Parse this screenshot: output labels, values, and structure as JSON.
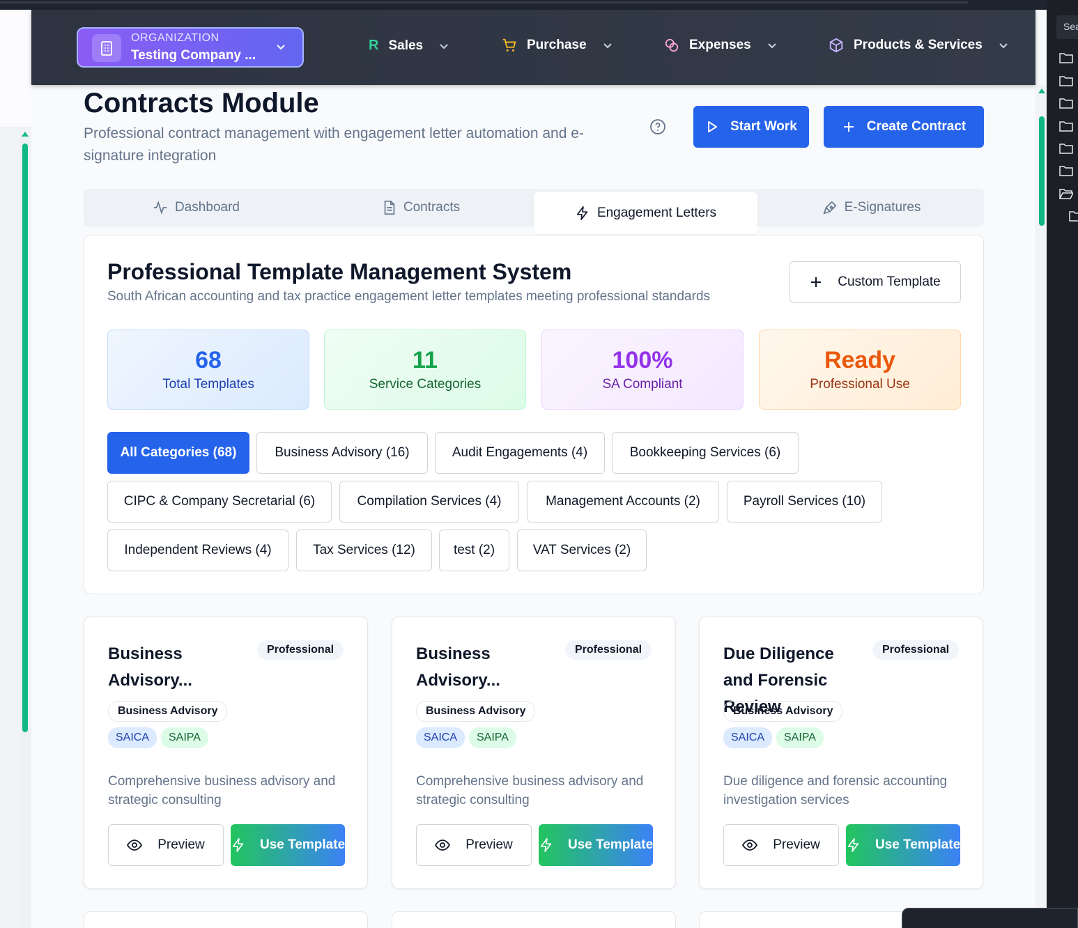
{
  "organization": {
    "label": "ORGANIZATION",
    "name": "Testing Company ..."
  },
  "nav": [
    {
      "label": "Sales",
      "icon": "r-letter-icon"
    },
    {
      "label": "Purchase",
      "icon": "cart-icon"
    },
    {
      "label": "Expenses",
      "icon": "coins-icon"
    },
    {
      "label": "Products & Services",
      "icon": "box-icon"
    }
  ],
  "page": {
    "title": "Contracts Module",
    "subtitle": "Professional contract management with engagement letter automation and e-signature integration",
    "start_work": "Start Work",
    "create_contract": "Create Contract"
  },
  "tabs": [
    {
      "label": "Dashboard"
    },
    {
      "label": "Contracts"
    },
    {
      "label": "Engagement Letters",
      "active": true
    },
    {
      "label": "E-Signatures"
    }
  ],
  "templates": {
    "title": "Professional Template Management System",
    "description": "South African accounting and tax practice engagement letter templates meeting professional standards",
    "custom_button": "Custom Template"
  },
  "stats": [
    {
      "value": "68",
      "label": "Total Templates",
      "color": "#2563eb"
    },
    {
      "value": "11",
      "label": "Service Categories",
      "color": "#16a34a"
    },
    {
      "value": "100%",
      "label": "SA Compliant",
      "color": "#9333ea"
    },
    {
      "value": "Ready",
      "label": "Professional Use",
      "color": "#ea580c"
    }
  ],
  "categories": [
    "All Categories (68)",
    "Business Advisory (16)",
    "Audit Engagements (4)",
    "Bookkeeping Services (6)",
    "CIPC & Company Secretarial (6)",
    "Compilation Services (4)",
    "Management Accounts (2)",
    "Payroll Services (10)",
    "Independent Reviews (4)",
    "Tax Services (12)",
    "test (2)",
    "VAT Services (2)"
  ],
  "cards": [
    {
      "title": "Business Advisory...",
      "badge": "Professional",
      "category": "Business Advisory",
      "tag1": "SAICA",
      "tag2": "SAIPA",
      "description": "Comprehensive business advisory and strategic consulting",
      "preview": "Preview",
      "use": "Use Template"
    },
    {
      "title": "Business Advisory...",
      "badge": "Professional",
      "category": "Business Advisory",
      "tag1": "SAICA",
      "tag2": "SAIPA",
      "description": "Comprehensive business advisory and strategic consulting",
      "preview": "Preview",
      "use": "Use Template"
    },
    {
      "title": "Due Diligence and Forensic Review",
      "badge": "Professional",
      "category": "Business Advisory",
      "tag1": "SAICA",
      "tag2": "SAIPA",
      "description": "Due diligence and forensic accounting investigation services",
      "preview": "Preview",
      "use": "Use Template"
    }
  ],
  "side_panel": {
    "search_text": "Sea"
  }
}
